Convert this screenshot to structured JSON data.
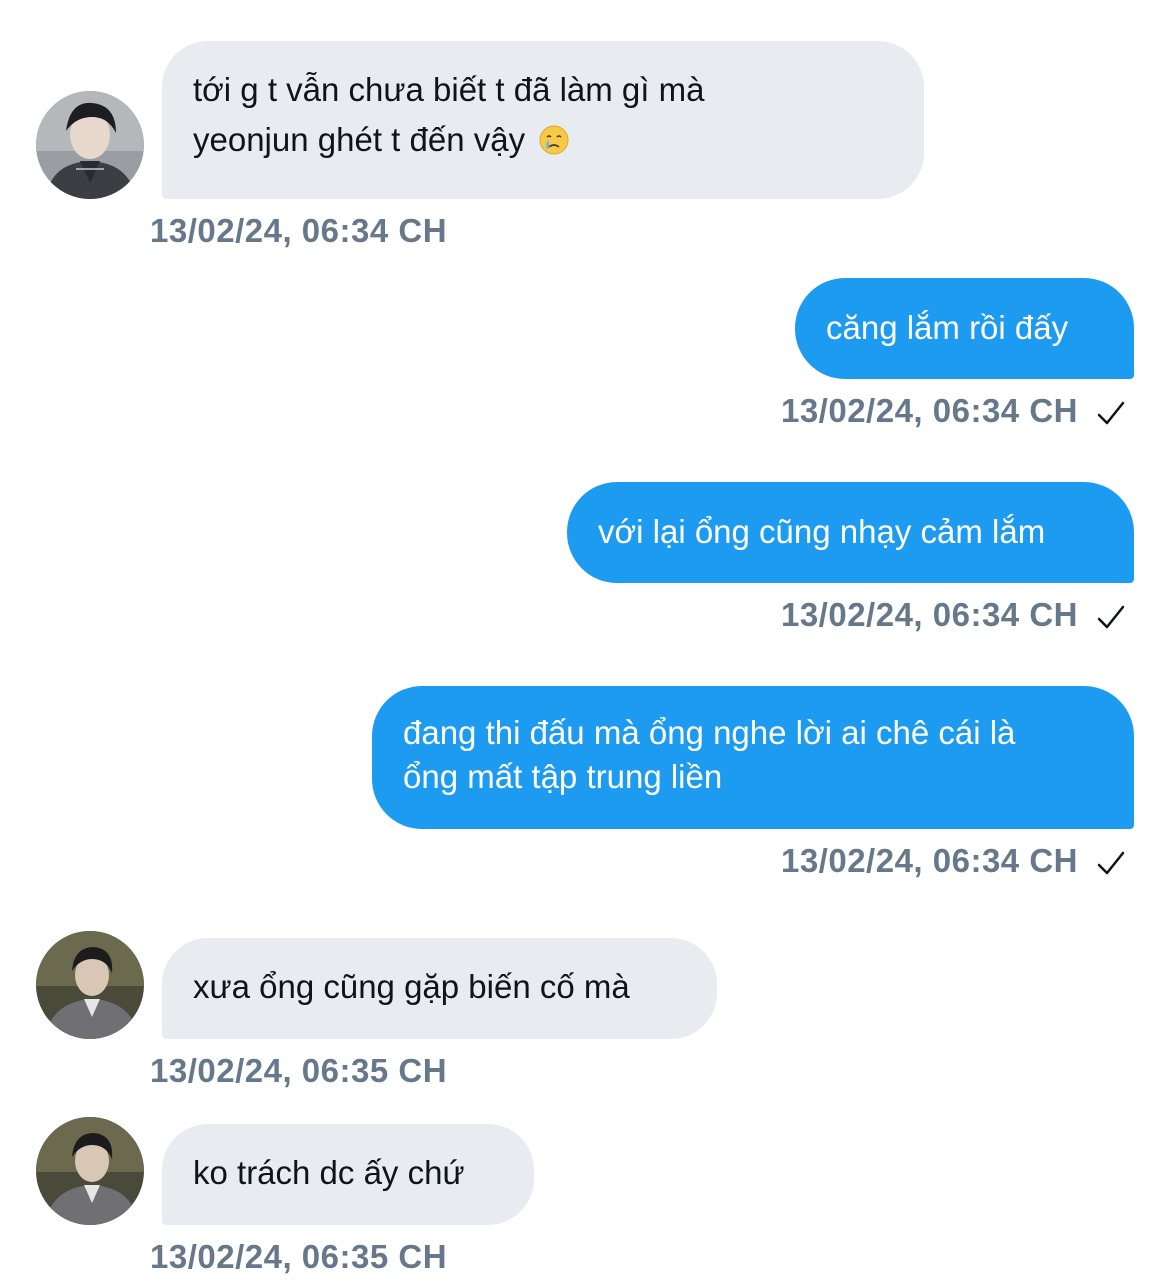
{
  "messages": [
    {
      "direction": "incoming",
      "lines": [
        "tới g t vẫn chưa biết t đã làm gì mà",
        "yeonjun ghét t đến vậy"
      ],
      "emoji": "crying-face-emoji",
      "time": "13/02/24, 06:34 CH",
      "avatar": "user-avatar-1"
    },
    {
      "direction": "outgoing",
      "lines": [
        "căng lắm rồi đấy"
      ],
      "time": "13/02/24, 06:34 CH",
      "status_icon": "checkmark-icon"
    },
    {
      "direction": "outgoing",
      "lines": [
        "với lại ổng cũng nhạy cảm lắm"
      ],
      "time": "13/02/24, 06:34 CH",
      "status_icon": "checkmark-icon"
    },
    {
      "direction": "outgoing",
      "lines": [
        "đang thi đấu mà ổng nghe lời ai chê cái là",
        "ổng mất tập trung liền"
      ],
      "time": "13/02/24, 06:34 CH",
      "status_icon": "checkmark-icon"
    },
    {
      "direction": "incoming",
      "lines": [
        "xưa ổng cũng gặp biến cố mà"
      ],
      "time": "13/02/24, 06:35 CH",
      "avatar": "user-avatar-2"
    },
    {
      "direction": "incoming",
      "lines": [
        "ko trách dc ấy chứ"
      ],
      "time": "13/02/24, 06:35 CH",
      "avatar": "user-avatar-2"
    }
  ],
  "colors": {
    "incoming_bubble": "#e8ecf0",
    "outgoing_bubble": "#1d9bf0",
    "timestamp": "#66788a",
    "incoming_text": "#0f1419",
    "outgoing_text": "#ffffff"
  }
}
